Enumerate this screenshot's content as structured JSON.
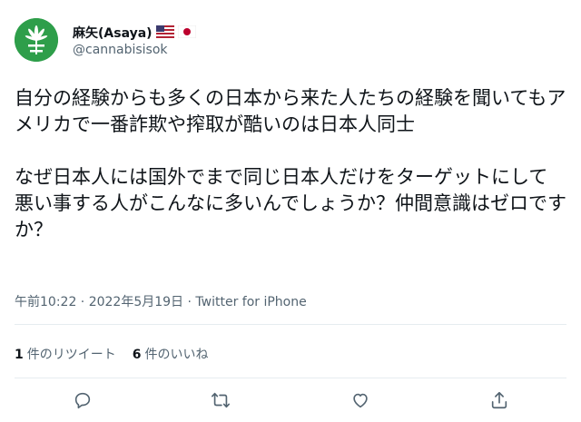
{
  "user": {
    "display_name": "麻矢(Asaya)",
    "handle": "@cannabisisok",
    "flags": [
      "us-flag-icon",
      "japan-flag-icon"
    ]
  },
  "tweet": {
    "text": "自分の経験からも多くの日本から来た人たちの経験を聞いてもアメリカで一番詐欺や搾取が酷いのは日本人同士\n\nなぜ日本人には国外でまで同じ日本人だけをターゲットにして悪い事する人がこんなに多いんでしょうか？仲間意識はゼロですか？",
    "meta": "午前10:22 · 2022年5月19日 · Twitter for iPhone"
  },
  "stats": {
    "retweets_count": "1",
    "retweets_label": "件のリツイート",
    "likes_count": "6",
    "likes_label": "件のいいね"
  },
  "actions": [
    "reply-icon",
    "retweet-icon",
    "like-icon",
    "share-icon"
  ],
  "colors": {
    "accent_green": "#2e9e4a",
    "secondary_text": "#536471",
    "icon_gray": "#536471"
  }
}
